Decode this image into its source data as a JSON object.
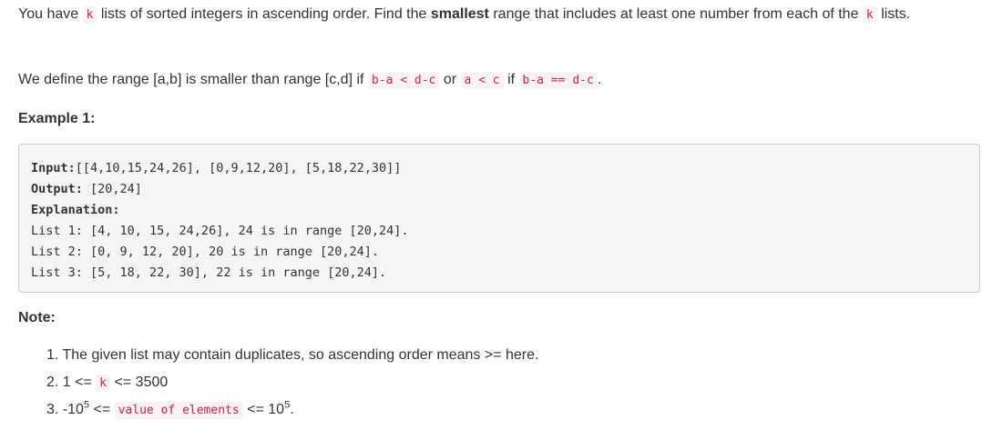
{
  "intro": {
    "t1": "You have ",
    "code_k": "k",
    "t2": " lists of sorted integers in ascending order. Find the ",
    "bold_smallest": "smallest",
    "t3": " range that includes at least one number from each of the ",
    "code_k2": "k",
    "t4": " lists."
  },
  "definition": {
    "t1": "We define the range [a,b] is smaller than range [c,d] if ",
    "code1": "b-a < d-c",
    "t2": " or ",
    "code2": "a < c",
    "t3": " if ",
    "code3": "b-a == d-c",
    "t4": "."
  },
  "example": {
    "heading": "Example 1:",
    "input_label": "Input:",
    "input_value": "[[4,10,15,24,26], [0,9,12,20], [5,18,22,30]]",
    "output_label": "Output:",
    "output_value": " [20,24]",
    "explanation_label": "Explanation:",
    "lines": [
      "List 1: [4, 10, 15, 24,26], 24 is in range [20,24].",
      "List 2: [0, 9, 12, 20], 20 is in range [20,24].",
      "List 3: [5, 18, 22, 30], 22 is in range [20,24]."
    ]
  },
  "note": {
    "heading": "Note:",
    "item1": "1. The given list may contain duplicates, so ascending order means >= here.",
    "item2_prefix": "2. 1 <= ",
    "item2_code": "k",
    "item2_suffix": " <= 3500",
    "item3_prefix": "3. -10",
    "item3_sup1": "5",
    "item3_mid": " <= ",
    "item3_code": "value of elements",
    "item3_mid2": " <= 10",
    "item3_sup2": "5",
    "item3_end": "."
  }
}
